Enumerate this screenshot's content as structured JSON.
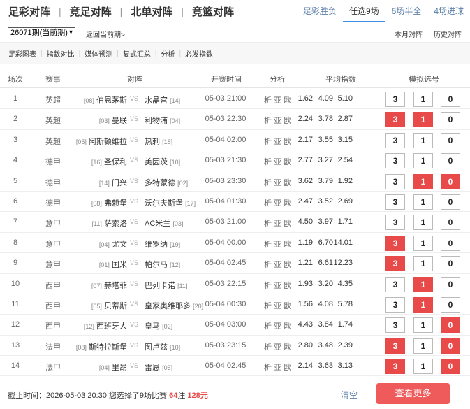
{
  "main_tabs": [
    "足彩对阵",
    "竞足对阵",
    "北单对阵",
    "竞篮对阵"
  ],
  "tab_separator": "|",
  "sub_tabs": [
    {
      "label": "足彩胜负",
      "active": false
    },
    {
      "label": "任选9场",
      "active": true
    },
    {
      "label": "6场半全",
      "active": false
    },
    {
      "label": "4场进球",
      "active": false
    }
  ],
  "period": {
    "selected": "26071期(当前期)",
    "caret": "▾"
  },
  "back_link": "返回当前期>",
  "right_links": [
    "本月对阵",
    "历史对阵"
  ],
  "toolbar": [
    "足彩图表",
    "指数对比",
    "媒体预测",
    "复式汇总",
    "分析",
    "必发指数"
  ],
  "headers": {
    "no": "场次",
    "league": "赛事",
    "match": "对阵",
    "time": "开赛时间",
    "analysis": "分析",
    "odds": "平均指数",
    "picks": "模拟选号"
  },
  "vs_label": "VS",
  "analysis_links": [
    "析",
    "亚",
    "欧"
  ],
  "pick_options": [
    "3",
    "1",
    "0"
  ],
  "matches": [
    {
      "no": "1",
      "league": "英超",
      "home_rank": "[08]",
      "home": "伯恩茅斯",
      "away": "水晶宫",
      "away_rank": "[14]",
      "time": "05-03 21:00",
      "odds": [
        "1.62",
        "4.09",
        "5.10"
      ],
      "picks": [
        false,
        false,
        false
      ]
    },
    {
      "no": "2",
      "league": "英超",
      "home_rank": "[03]",
      "home": "曼联",
      "away": "利物浦",
      "away_rank": "[04]",
      "time": "05-03 22:30",
      "odds": [
        "2.24",
        "3.78",
        "2.87"
      ],
      "picks": [
        true,
        true,
        false
      ]
    },
    {
      "no": "3",
      "league": "英超",
      "home_rank": "[05]",
      "home": "阿斯顿维拉",
      "away": "热刺",
      "away_rank": "[18]",
      "time": "05-04 02:00",
      "odds": [
        "2.17",
        "3.55",
        "3.15"
      ],
      "picks": [
        false,
        false,
        false
      ]
    },
    {
      "no": "4",
      "league": "德甲",
      "home_rank": "[16]",
      "home": "圣保利",
      "away": "美因茨",
      "away_rank": "[10]",
      "time": "05-03 21:30",
      "odds": [
        "2.77",
        "3.27",
        "2.54"
      ],
      "picks": [
        false,
        false,
        false
      ]
    },
    {
      "no": "5",
      "league": "德甲",
      "home_rank": "[14]",
      "home": "门兴",
      "away": "多特蒙德",
      "away_rank": "[02]",
      "time": "05-03 23:30",
      "odds": [
        "3.62",
        "3.79",
        "1.92"
      ],
      "picks": [
        false,
        true,
        true
      ]
    },
    {
      "no": "6",
      "league": "德甲",
      "home_rank": "[08]",
      "home": "弗赖堡",
      "away": "沃尔夫斯堡",
      "away_rank": "[17]",
      "time": "05-04 01:30",
      "odds": [
        "2.47",
        "3.52",
        "2.69"
      ],
      "picks": [
        false,
        false,
        false
      ]
    },
    {
      "no": "7",
      "league": "意甲",
      "home_rank": "[11]",
      "home": "萨索洛",
      "away": "AC米兰",
      "away_rank": "[03]",
      "time": "05-03 21:00",
      "odds": [
        "4.50",
        "3.97",
        "1.71"
      ],
      "picks": [
        false,
        false,
        false
      ]
    },
    {
      "no": "8",
      "league": "意甲",
      "home_rank": "[04]",
      "home": "尤文",
      "away": "维罗纳",
      "away_rank": "[19]",
      "time": "05-04 00:00",
      "odds": [
        "1.19",
        "6.70",
        "14.01"
      ],
      "picks": [
        true,
        false,
        false
      ]
    },
    {
      "no": "9",
      "league": "意甲",
      "home_rank": "[01]",
      "home": "国米",
      "away": "帕尔马",
      "away_rank": "[12]",
      "time": "05-04 02:45",
      "odds": [
        "1.21",
        "6.61",
        "12.23"
      ],
      "picks": [
        true,
        false,
        false
      ]
    },
    {
      "no": "10",
      "league": "西甲",
      "home_rank": "[07]",
      "home": "赫塔菲",
      "away": "巴列卡诺",
      "away_rank": "[11]",
      "time": "05-03 22:15",
      "odds": [
        "1.93",
        "3.20",
        "4.35"
      ],
      "picks": [
        false,
        true,
        false
      ]
    },
    {
      "no": "11",
      "league": "西甲",
      "home_rank": "[05]",
      "home": "贝蒂斯",
      "away": "皇家奥维耶多",
      "away_rank": "[20]",
      "time": "05-04 00:30",
      "odds": [
        "1.56",
        "4.08",
        "5.78"
      ],
      "picks": [
        false,
        true,
        false
      ]
    },
    {
      "no": "12",
      "league": "西甲",
      "home_rank": "[12]",
      "home": "西班牙人",
      "away": "皇马",
      "away_rank": "[02]",
      "time": "05-04 03:00",
      "odds": [
        "4.43",
        "3.84",
        "1.74"
      ],
      "picks": [
        false,
        false,
        true
      ]
    },
    {
      "no": "13",
      "league": "法甲",
      "home_rank": "[08]",
      "home": "斯特拉斯堡",
      "away": "图卢兹",
      "away_rank": "[10]",
      "time": "05-03 23:15",
      "odds": [
        "2.80",
        "3.48",
        "2.39"
      ],
      "picks": [
        true,
        false,
        true
      ]
    },
    {
      "no": "14",
      "league": "法甲",
      "home_rank": "[04]",
      "home": "里昂",
      "away": "雷恩",
      "away_rank": "[05]",
      "time": "05-04 02:45",
      "odds": [
        "2.14",
        "3.63",
        "3.13"
      ],
      "picks": [
        true,
        false,
        true
      ]
    }
  ],
  "footer": {
    "deadline_prefix": "截止时间：2026-05-03 20:30 您选择了9场比赛,",
    "bets": "64",
    "bets_unit": "注",
    "amount": "128元",
    "clear": "清空",
    "more": "查看更多"
  },
  "colors": {
    "accent": "#e84a4a",
    "link": "#5b7fa8",
    "active_tab": "#3a8ee6"
  }
}
